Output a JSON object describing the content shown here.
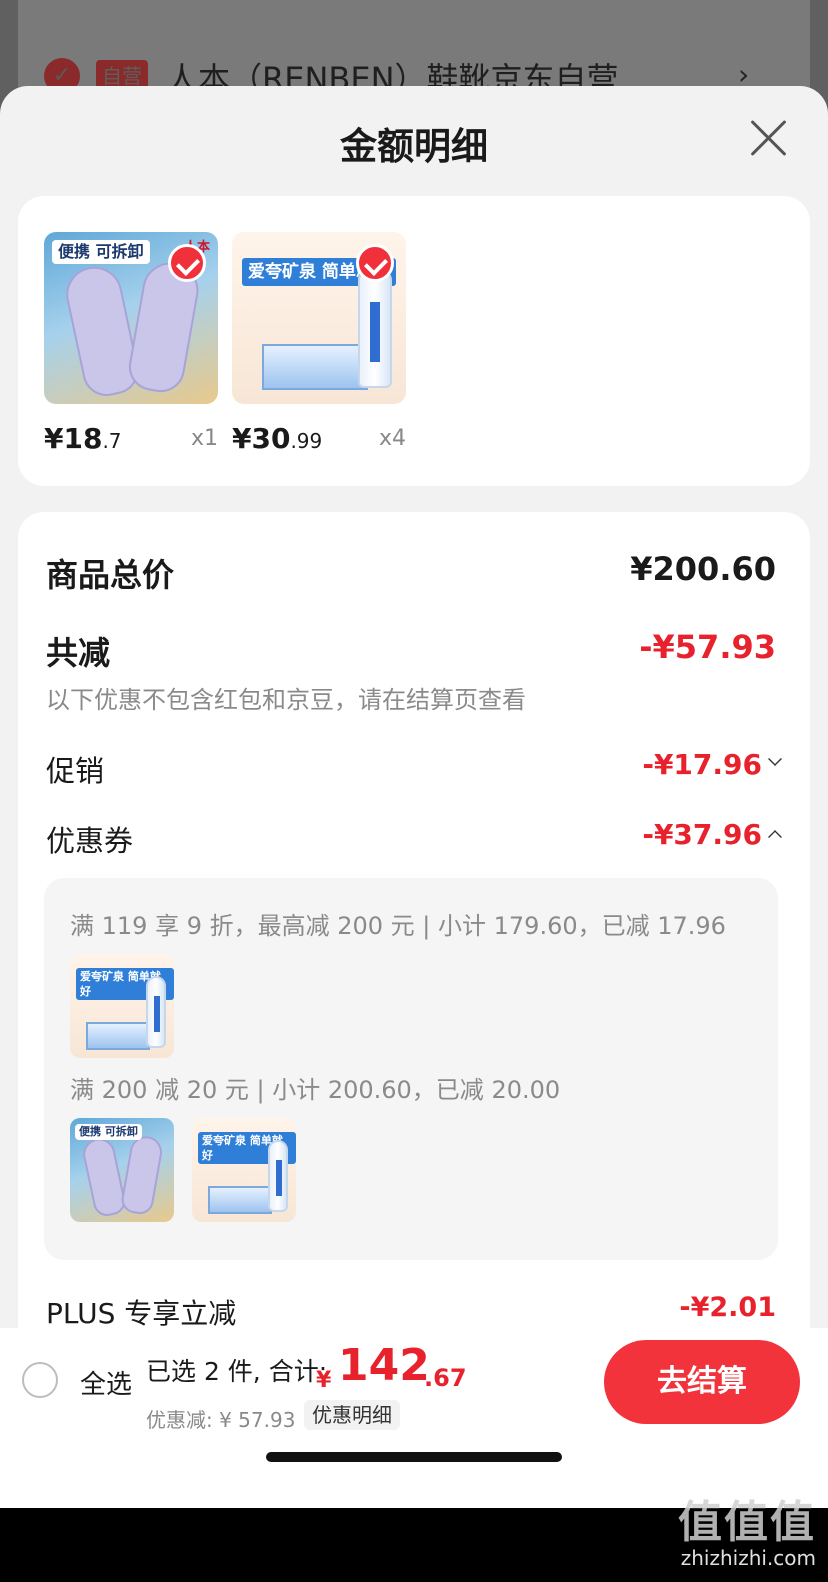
{
  "store": {
    "tag": "自营",
    "name": "人本（RENBEN）鞋靴京东自营..."
  },
  "sheet": {
    "title": "金额明细"
  },
  "products": [
    {
      "price_int": "¥18",
      "price_dec": ".7",
      "qty": "x1",
      "badge": "便携 可拆卸",
      "art": "insole"
    },
    {
      "price_int": "¥30",
      "price_dec": ".99",
      "qty": "x4",
      "badge": "爱夸矿泉 简单就好",
      "art": "water"
    }
  ],
  "detail": {
    "total_label": "商品总价",
    "total_value": "¥200.60",
    "reduce_label": "共减",
    "reduce_value": "-¥57.93",
    "note": "以下优惠不包含红包和京豆，请在结算页查看",
    "promo_label": "促销",
    "promo_value": "-¥17.96",
    "coupon_label": "优惠券",
    "coupon_value": "-¥37.96",
    "coupons": [
      {
        "text": "满 119 享 9 折，最高减 200 元 | 小计 179.60，已减 17.96"
      },
      {
        "text": "满 200 减 20 元 | 小计 200.60，已减 20.00"
      }
    ],
    "plus_label": "PLUS 专享立减",
    "plus_value": "-¥2.01"
  },
  "bottom": {
    "select_all": "全选",
    "summary": "已选 2 件, 合计:",
    "currency": "¥",
    "amount_int": "142",
    "amount_dec": ".67",
    "discount": "优惠减: ¥ 57.93",
    "detail_link": "优惠明细",
    "checkout": "去结算"
  },
  "watermark": {
    "mark": "值值值",
    "url": "zhizhizhi.com"
  },
  "colors": {
    "accent_red": "#e8222c",
    "checkout_red": "#f2333b"
  }
}
